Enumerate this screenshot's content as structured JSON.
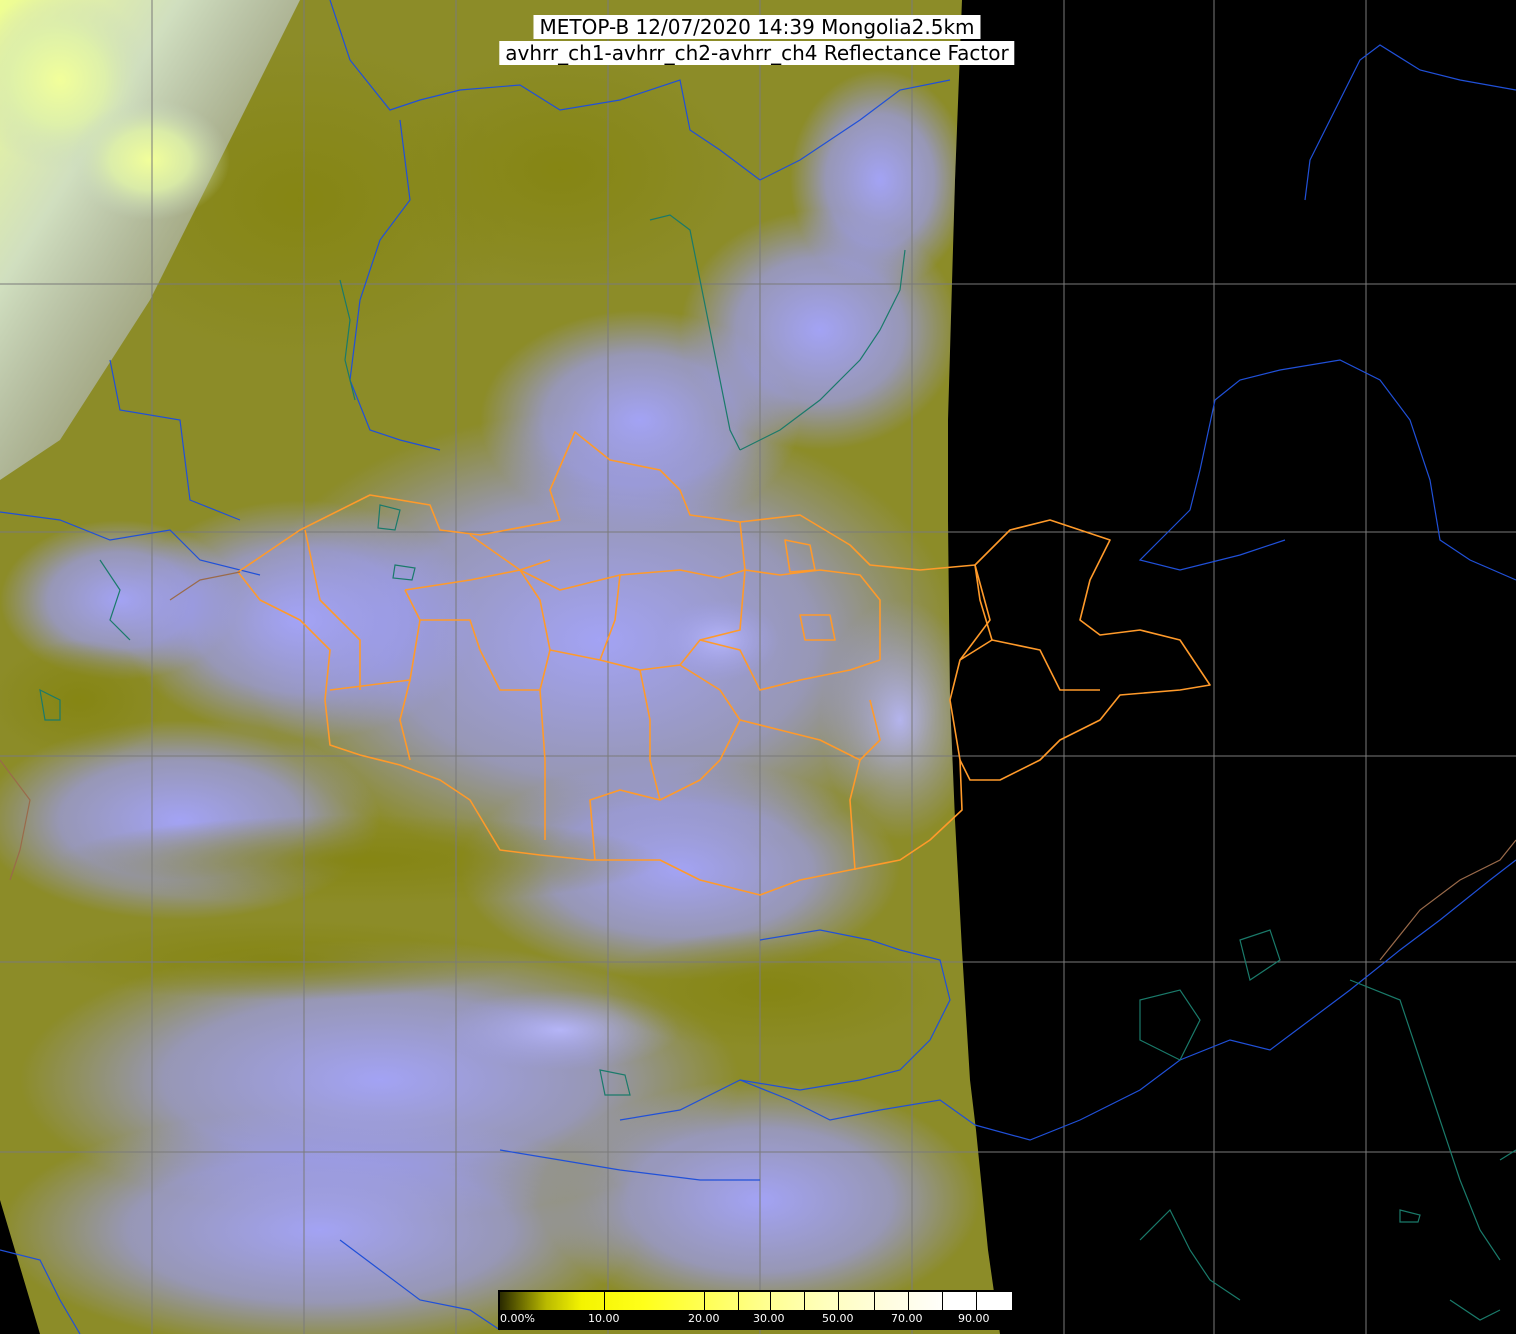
{
  "title": {
    "line1": "METOP-B 12/07/2020 14:39 Mongolia2.5km",
    "line2": "avhrr_ch1-avhrr_ch2-avhrr_ch4 Reflectance Factor"
  },
  "colorbar": {
    "labels": [
      "0.00%",
      "10.00",
      "20.00",
      "30.00",
      "50.00",
      "70.00",
      "90.00"
    ]
  },
  "colors": {
    "background": "#000000",
    "land_olive": "#8a8a1e",
    "cloud_lavender": "#9a9af0",
    "mongolia_border": "#ff9a2a",
    "coastline": "#1f5fd0",
    "lake_outline": "#1f8070",
    "graticule": "#808080"
  }
}
